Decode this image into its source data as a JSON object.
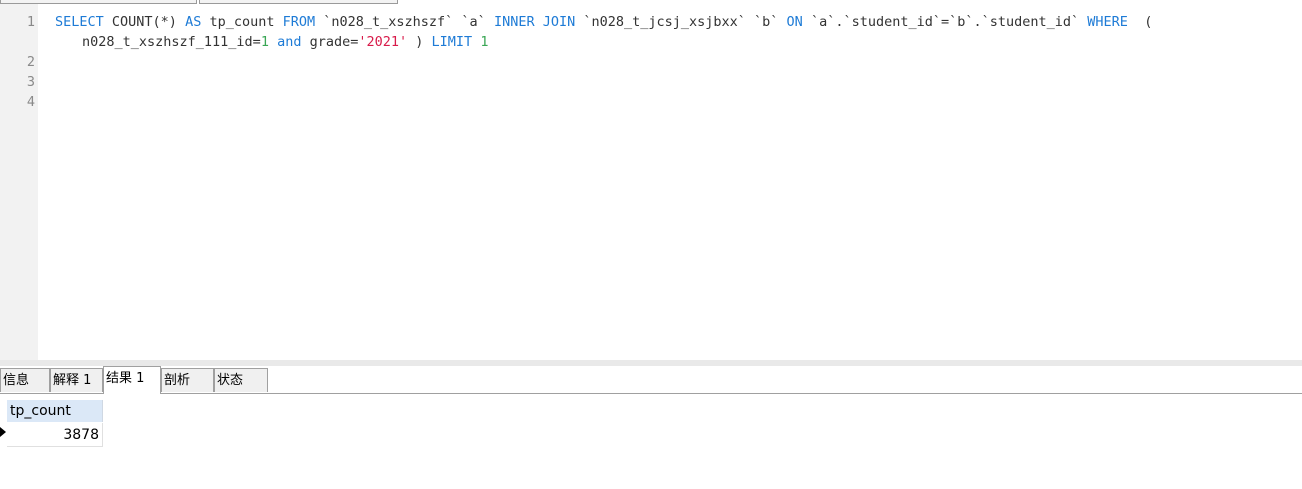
{
  "editor": {
    "line_numbers": [
      "1",
      "2",
      "3",
      "4"
    ],
    "line1": {
      "select": "SELECT",
      "count_expr": " COUNT(*) ",
      "as": "AS",
      "alias": " tp_count ",
      "from": "FROM",
      "table_a": " `n028_t_xszhszf` `a` ",
      "inner_join": "INNER JOIN",
      "table_b": " `n028_t_jcsj_xsjbxx` `b` ",
      "on": "ON",
      "join_cond": " `a`.`student_id`=`b`.`student_id` ",
      "where": "WHERE",
      "open_paren": "  ("
    },
    "line1_wrap": {
      "cond_field": "n028_t_xszhszf_111_id=",
      "cond_value": "1",
      "and_kw": " and",
      "grade_field": " grade=",
      "grade_value": "'2021'",
      "close_paren": " ) ",
      "limit": "LIMIT",
      "limit_value": " 1"
    }
  },
  "tabs": [
    {
      "label": "信息"
    },
    {
      "label": "解释 1"
    },
    {
      "label": "结果 1"
    },
    {
      "label": "剖析"
    },
    {
      "label": "状态"
    }
  ],
  "results": {
    "column": "tp_count",
    "value": "3878"
  }
}
